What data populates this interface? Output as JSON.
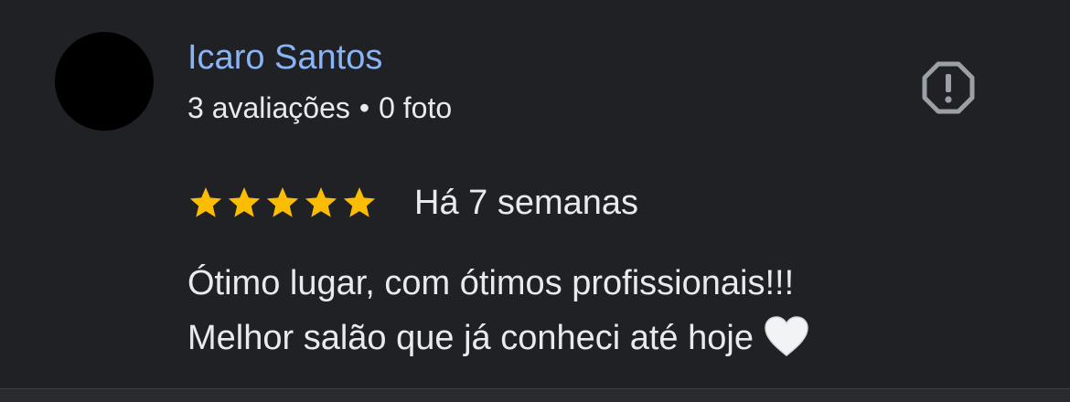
{
  "reviewer": {
    "name": "Icaro Santos",
    "reviews_count": "3 avaliações",
    "separator": "•",
    "photos_count": "0 foto"
  },
  "review": {
    "rating": 5,
    "rating_max": 5,
    "time_ago": "Há 7 semanas",
    "text_line1": "Ótimo lugar, com ótimos profissionais!!!",
    "text_line2": "Melhor salão que já conheci até hoje"
  },
  "icons": {
    "report": "report-flag-icon",
    "star": "star-icon",
    "heart": "white-heart-emoji-icon"
  },
  "colors": {
    "background": "#202124",
    "name": "#8ab4f8",
    "text": "#e8eaed",
    "star": "#fbbc04",
    "icon": "#9aa0a6"
  }
}
